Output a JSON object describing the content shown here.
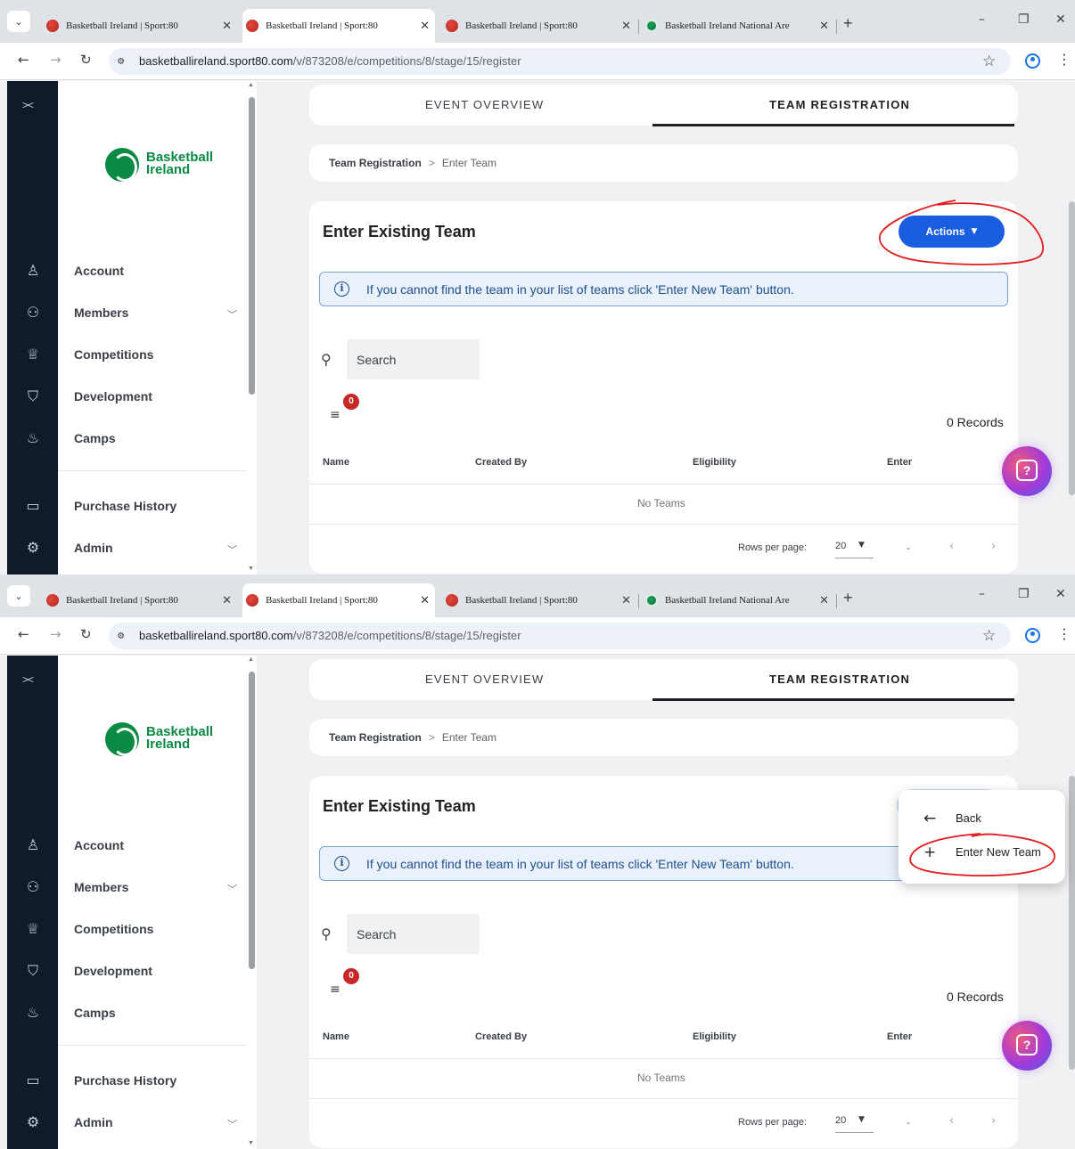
{
  "browser": {
    "tabs": [
      {
        "title": "Basketball Ireland | Sport:80"
      },
      {
        "title": "Basketball Ireland | Sport:80"
      },
      {
        "title": "Basketball Ireland | Sport:80"
      },
      {
        "title": "Basketball Ireland National Are"
      }
    ],
    "active_tab_index": 1,
    "url_host": "basketballireland.sport80.com",
    "url_path": "/v/873208/e/competitions/8/stage/15/register"
  },
  "sidebar": {
    "logo_line1": "Basketball",
    "logo_line2": "Ireland",
    "items": [
      {
        "label": "Account",
        "icon": "person-icon"
      },
      {
        "label": "Members",
        "icon": "group-icon",
        "expandable": true
      },
      {
        "label": "Competitions",
        "icon": "trophy-icon"
      },
      {
        "label": "Development",
        "icon": "graduation-cap-icon"
      },
      {
        "label": "Camps",
        "icon": "campfire-icon"
      },
      {
        "label": "Purchase History",
        "icon": "wallet-icon"
      },
      {
        "label": "Admin",
        "icon": "gear-icon",
        "expandable": true
      }
    ]
  },
  "main": {
    "tabs": [
      {
        "label": "EVENT OVERVIEW",
        "active": false
      },
      {
        "label": "TEAM REGISTRATION",
        "active": true
      }
    ],
    "breadcrumb": {
      "root": "Team Registration",
      "separator": ">",
      "current": "Enter Team"
    },
    "title": "Enter Existing Team",
    "actions_label": "Actions",
    "info_text": "If you cannot find the team in your list of teams click 'Enter New Team' button.",
    "search_placeholder": "Search",
    "filter_count": "0",
    "records": "0 Records",
    "columns": [
      "Name",
      "Created By",
      "Eligibility",
      "Enter"
    ],
    "empty_text": "No Teams",
    "rows_per_page_label": "Rows per page:",
    "rows_per_page_value": "20",
    "page_range": "-"
  },
  "actions_menu": {
    "items": [
      {
        "label": "Back",
        "icon": "arrow-left-icon"
      },
      {
        "label": "Enter New Team",
        "icon": "plus-icon"
      }
    ]
  },
  "colors": {
    "primary": "#1a5de0",
    "rail": "#0f1a2b",
    "brand_green": "#0b8a43",
    "badge_red": "#c62828",
    "annotation_red": "#e01b1b"
  }
}
